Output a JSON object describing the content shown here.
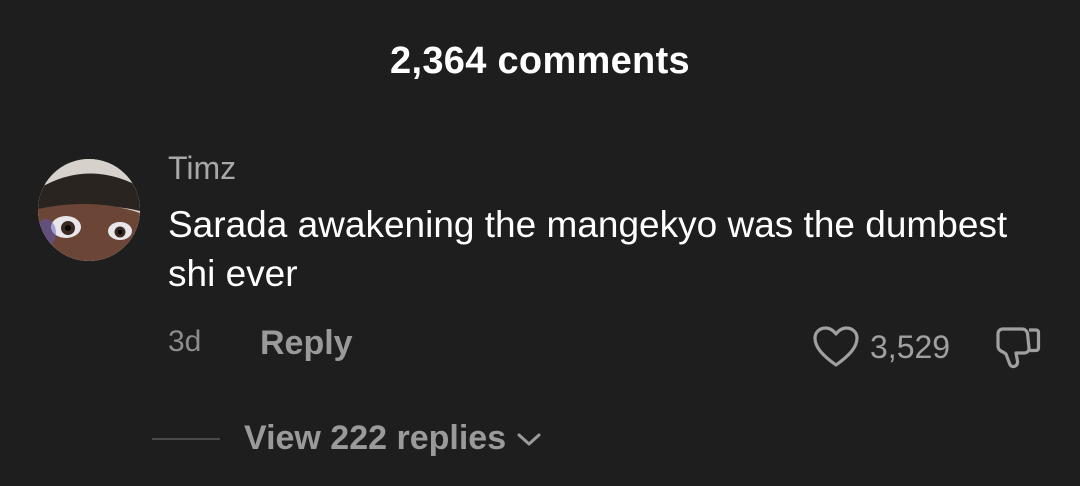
{
  "header": {
    "title": "2,364 comments"
  },
  "comment": {
    "username": "Timz",
    "text": "Sarada awakening the mangekyo was the dumbest shi ever",
    "age": "3d",
    "reply_label": "Reply",
    "like_count": "3,529",
    "like_icon": "heart-outline-icon",
    "dislike_icon": "thumbs-down-outline-icon",
    "view_replies_label": "View 222 replies",
    "view_replies_icon": "chevron-down-icon"
  },
  "colors": {
    "background": "#1e1e1e",
    "primary_text": "#ffffff",
    "secondary_text": "#a8a8a8",
    "muted_text": "#8c8c8c"
  }
}
